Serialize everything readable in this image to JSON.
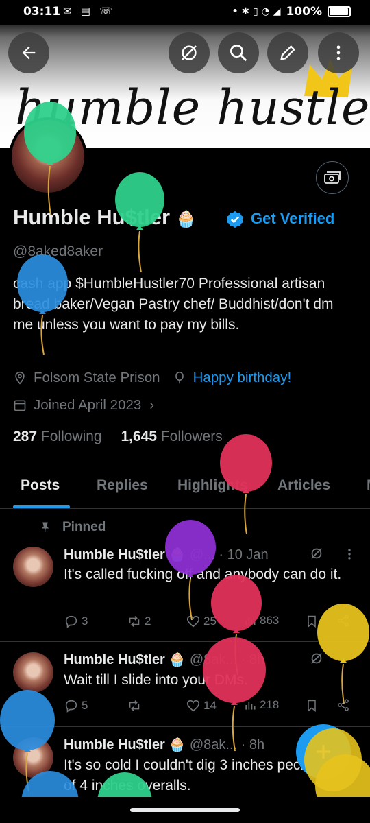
{
  "status_bar": {
    "time": "03:11",
    "left_icons": "gmail-icon calendar-icon missed-call-icon",
    "battery_pct": "100%"
  },
  "banner": {
    "text": "humble hustler"
  },
  "profile": {
    "name": "Humble Hu$tler",
    "name_emoji": "🧁",
    "get_verified": "Get Verified",
    "handle": "@8aked8aker",
    "bio": "cash app $HumbleHustler70 Professional artisan bread baker/Vegan Pastry chef/ Buddhist/don't dm me unless you want to pay my bills.",
    "location": "Folsom State Prison",
    "birthday": "Happy birthday!",
    "joined": "Joined April 2023",
    "following_count": "287",
    "following_label": "Following",
    "followers_count": "1,645",
    "followers_label": "Followers"
  },
  "tabs": [
    "Posts",
    "Replies",
    "Highlights",
    "Articles",
    "M"
  ],
  "pinned_label": "Pinned",
  "posts": [
    {
      "name": "Humble Hu$tler",
      "emoji": "🧁",
      "handle": "@...",
      "time": "· 10 Jan",
      "text": "It's called fucking off and anybody can do it.",
      "replies": "3",
      "reposts": "2",
      "likes": "25",
      "views": "863"
    },
    {
      "name": "Humble Hu$tler",
      "emoji": "🧁",
      "handle": "@8ak...",
      "time": "· 8h",
      "text": "Wait till I slide into your DMs.",
      "replies": "5",
      "reposts": "",
      "likes": "14",
      "views": "218"
    },
    {
      "name": "Humble Hu$tler",
      "emoji": "🧁",
      "handle": "@8ak...",
      "time": "· 8h",
      "text": "It's so cold I couldn't dig 3 inches pecker out of 4 inches overalls."
    }
  ],
  "colors": {
    "accent": "#1d9bf0",
    "muted": "#71767b",
    "balloon_green": "#2fd08a",
    "balloon_blue": "#2b8ee0",
    "balloon_red": "#e0325a",
    "balloon_purple": "#8d2fd3",
    "balloon_yellow": "#e6c21c"
  }
}
